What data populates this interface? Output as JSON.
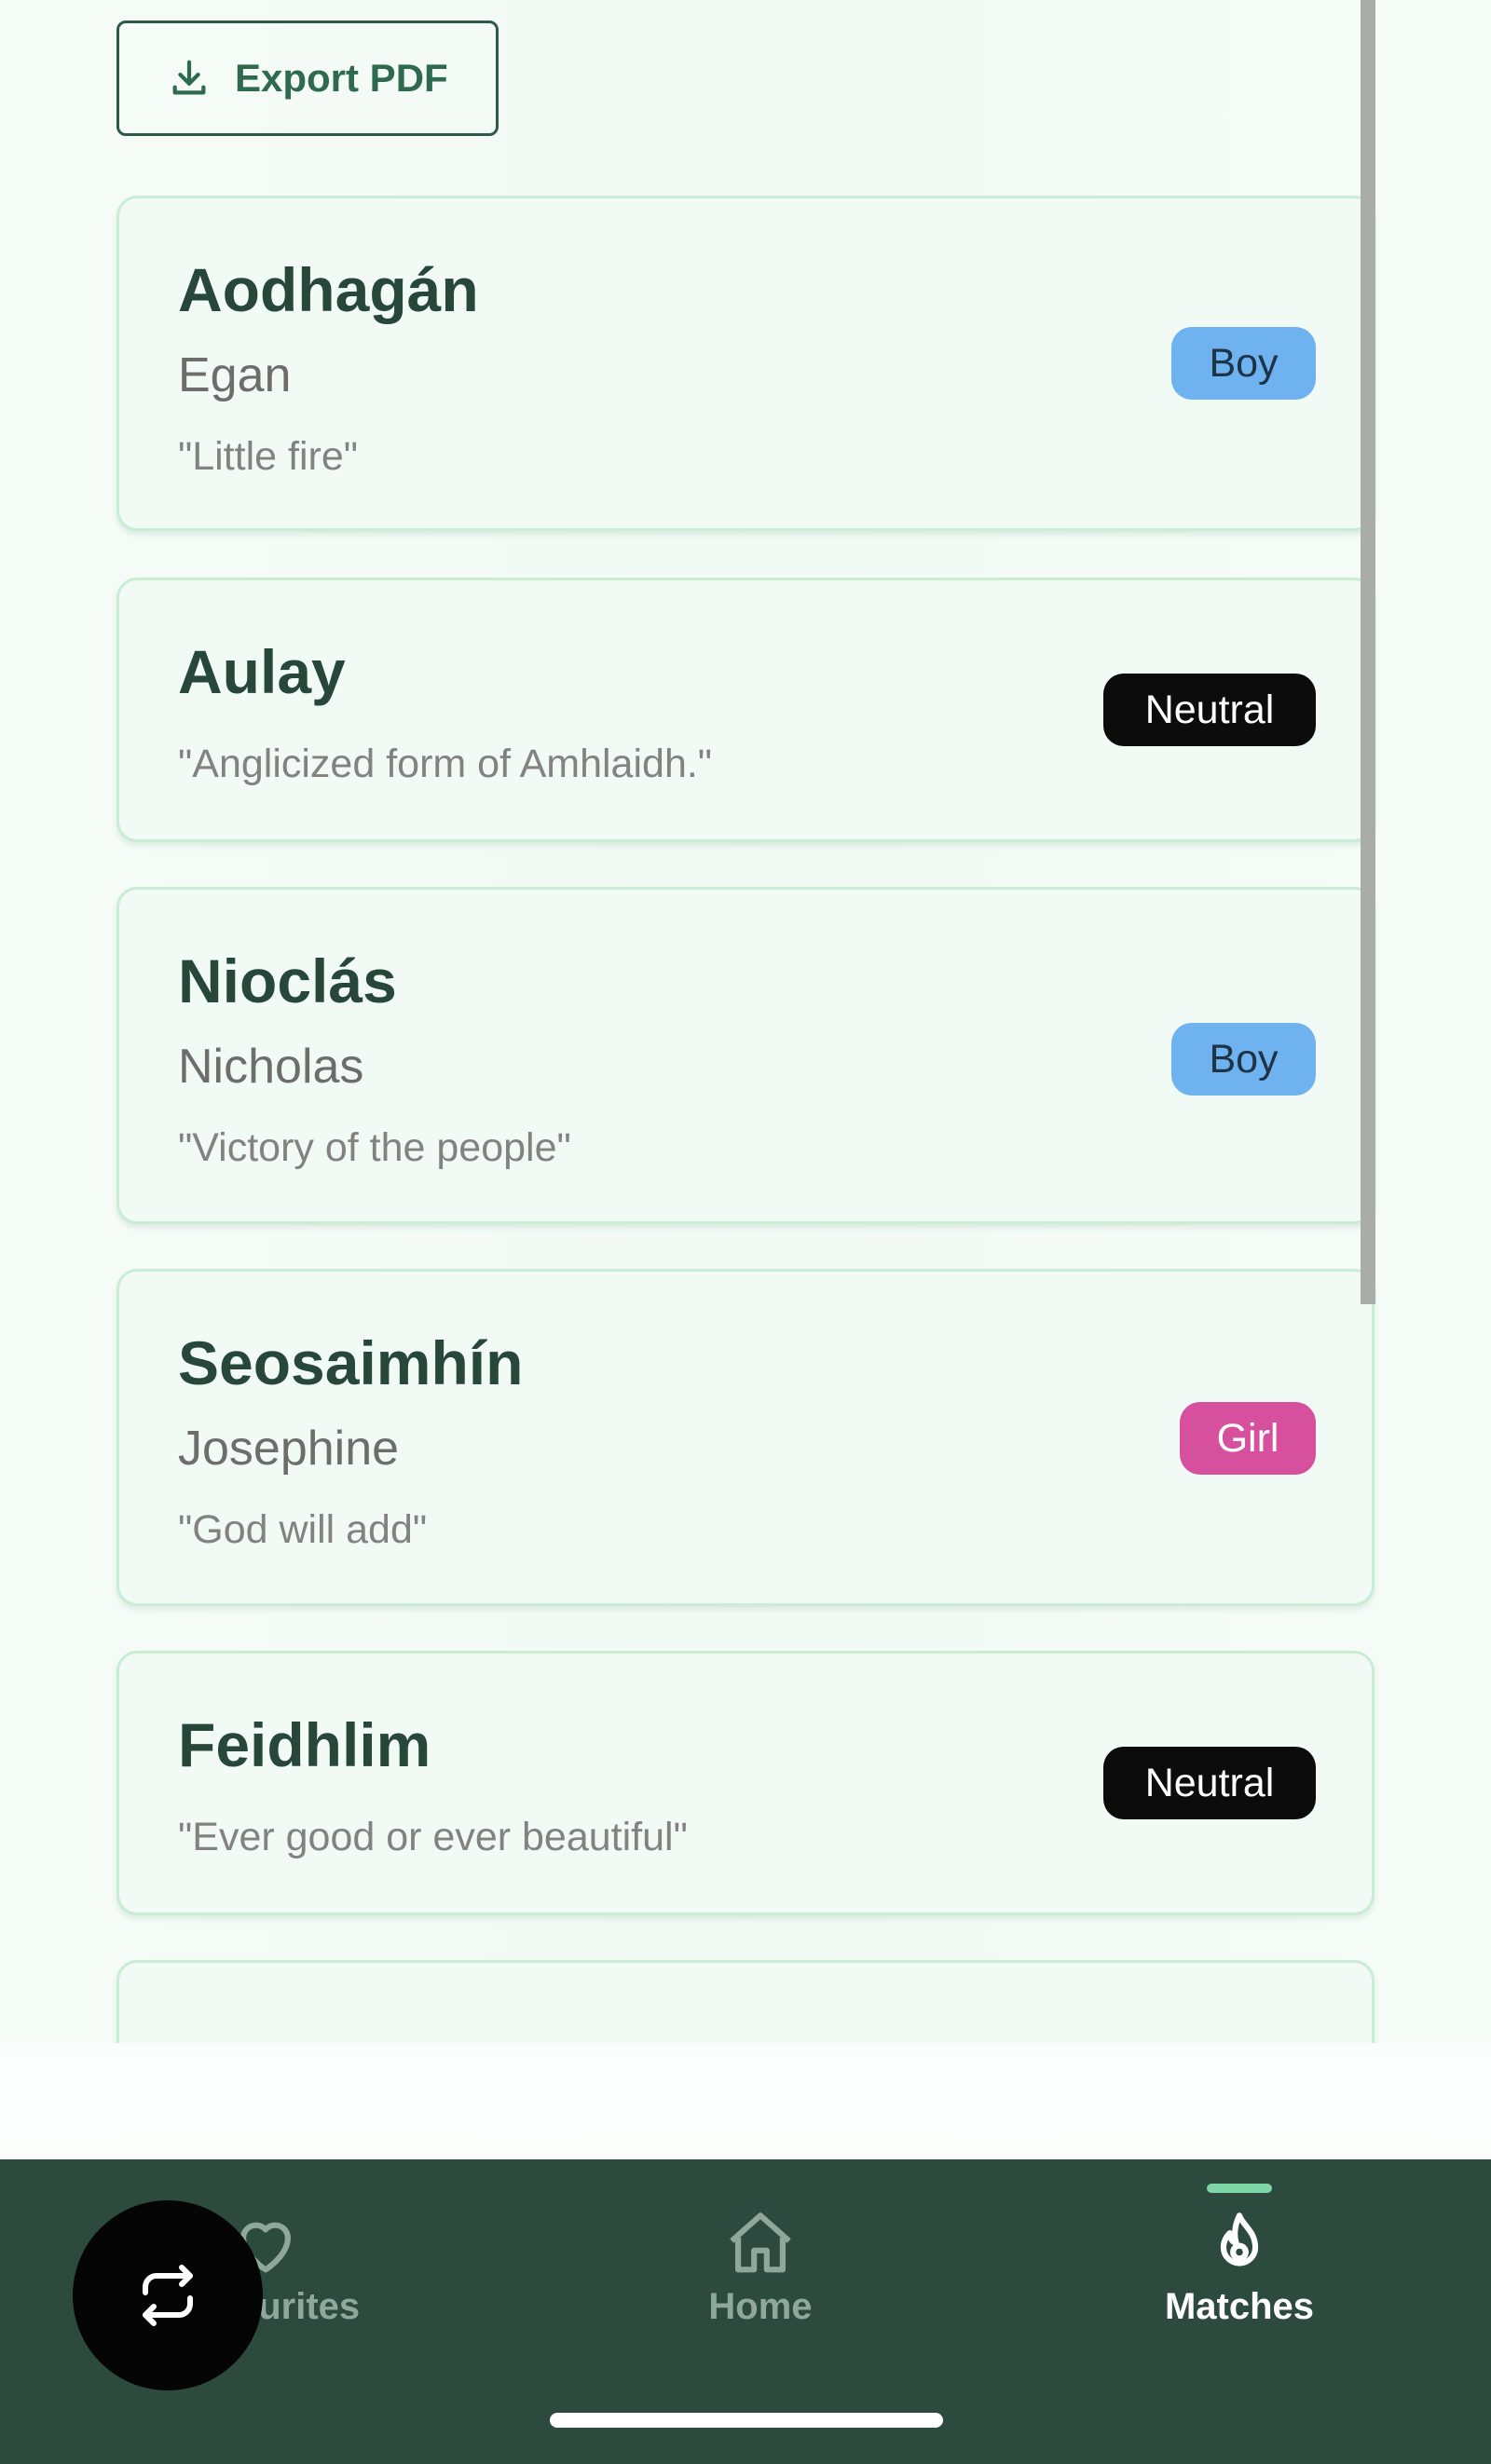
{
  "toolbar": {
    "export_label": "Export PDF"
  },
  "names": [
    {
      "name": "Aodhagán",
      "english": "Egan",
      "meaning": "\"Little fire\"",
      "gender": "Boy"
    },
    {
      "name": "Aulay",
      "english": "",
      "meaning": "\"Anglicized form of Amhlaidh.\"",
      "gender": "Neutral"
    },
    {
      "name": "Nioclás",
      "english": "Nicholas",
      "meaning": "\"Victory of the people\"",
      "gender": "Boy"
    },
    {
      "name": "Seosaimhín",
      "english": "Josephine",
      "meaning": "\"God will add\"",
      "gender": "Girl"
    },
    {
      "name": "Feidhlim",
      "english": "",
      "meaning": "\"Ever good or ever beautiful\"",
      "gender": "Neutral"
    }
  ],
  "nav": {
    "items": [
      {
        "label": "Favourites",
        "icon": "heart-icon",
        "active": false
      },
      {
        "label": "Home",
        "icon": "home-icon",
        "active": false
      },
      {
        "label": "Matches",
        "icon": "flame-icon",
        "active": true
      }
    ]
  },
  "fab": {
    "icon": "repeat-icon"
  },
  "colors": {
    "brand_dark": "#2c4a3d",
    "card_bg": "#f1faf4",
    "card_border": "#c9ecd5",
    "boy": "#6eb2ef",
    "girl": "#d6509d",
    "neutral": "#0c0c0c",
    "active_indicator": "#7fd6a6"
  }
}
